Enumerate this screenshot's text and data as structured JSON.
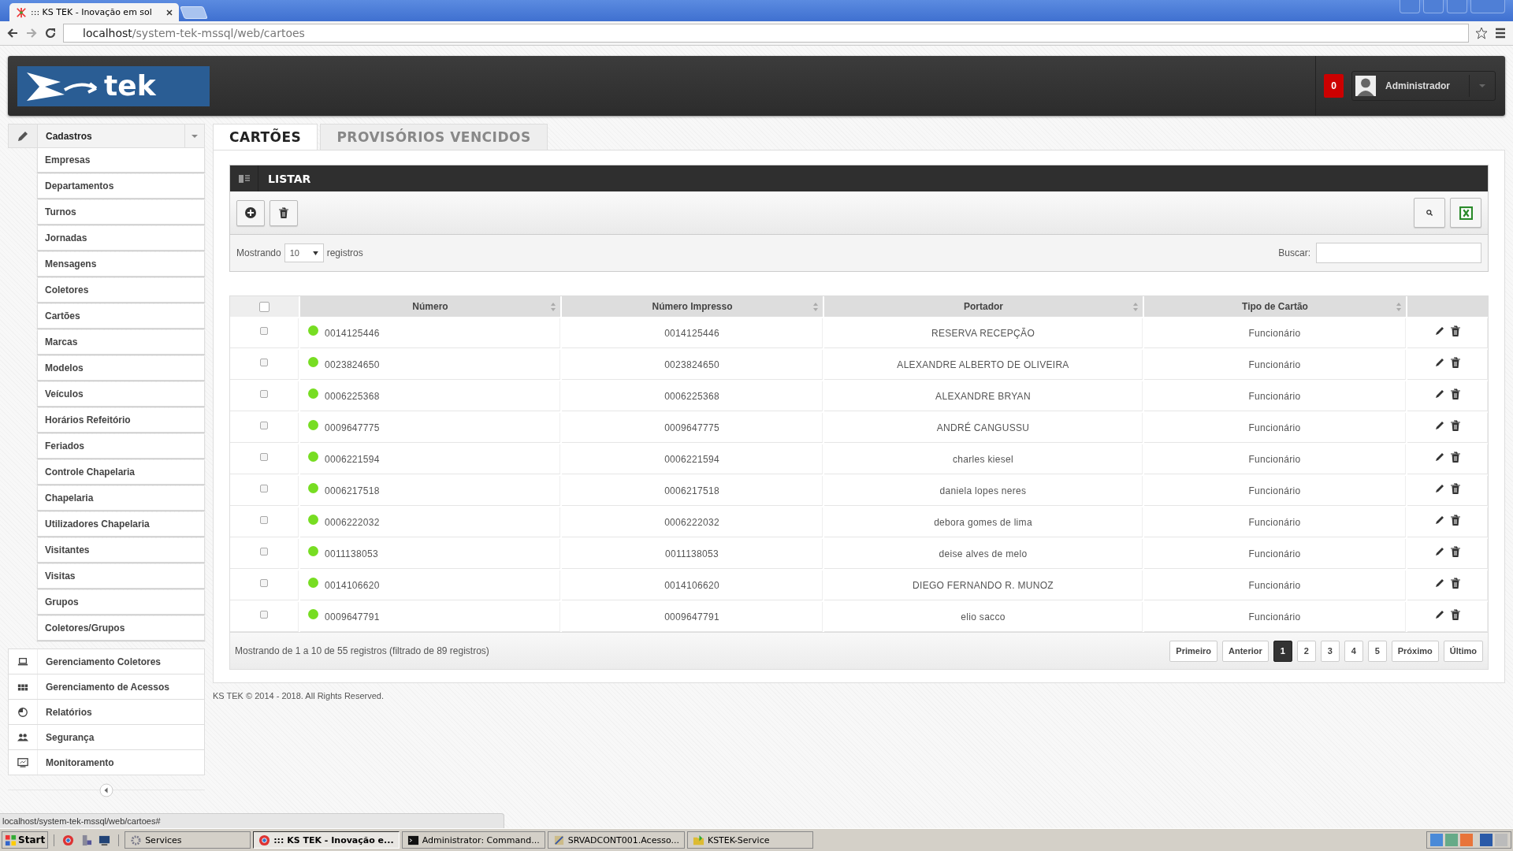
{
  "browser": {
    "tab_title": "::: KS TEK - Inovação em sol",
    "address_host": "localhost",
    "address_path": "/system-tek-mssql/web/cartoes"
  },
  "header": {
    "logo_text": "tek",
    "notification_count": "0",
    "user": "Administrador"
  },
  "sidebar": {
    "section": {
      "label": "Cadastros",
      "expanded": true,
      "children": [
        {
          "label": "Empresas"
        },
        {
          "label": "Departamentos"
        },
        {
          "label": "Turnos"
        },
        {
          "label": "Jornadas"
        },
        {
          "label": "Mensagens"
        },
        {
          "label": "Coletores"
        },
        {
          "label": "Cartões"
        },
        {
          "label": "Marcas"
        },
        {
          "label": "Modelos"
        },
        {
          "label": "Veículos"
        },
        {
          "label": "Horários Refeitório"
        },
        {
          "label": "Feriados"
        },
        {
          "label": "Controle Chapelaria"
        },
        {
          "label": "Chapelaria"
        },
        {
          "label": "Utilizadores Chapelaria"
        },
        {
          "label": "Visitantes"
        },
        {
          "label": "Visitas"
        },
        {
          "label": "Grupos"
        },
        {
          "label": "Coletores/Grupos"
        }
      ]
    },
    "modules": [
      {
        "label": "Gerenciamento Coletores",
        "kind": "laptop"
      },
      {
        "label": "Gerenciamento de Acessos",
        "kind": "grid"
      },
      {
        "label": "Relatórios",
        "kind": "pie"
      },
      {
        "label": "Segurança",
        "kind": "users"
      },
      {
        "label": "Monitoramento",
        "kind": "monitor"
      }
    ]
  },
  "tabs": [
    {
      "label": "CARTÕES",
      "selected": true
    },
    {
      "label": "PROVISÓRIOS VENCIDOS",
      "selected": false
    }
  ],
  "panel": {
    "title": "LISTAR",
    "length_label": "Mostrando",
    "length_value": "10",
    "length_suffix": "registros",
    "search_label": "Buscar:"
  },
  "table": {
    "select_all_checked": false,
    "columns": [
      {
        "label": "Número"
      },
      {
        "label": "Número Impresso"
      },
      {
        "label": "Portador"
      },
      {
        "label": "Tipo de Cartão"
      }
    ],
    "rows": [
      {
        "checked": false,
        "color": "#77dd22",
        "numero": "0014125446",
        "numero_impresso": "0014125446",
        "portador": "RESERVA RECEPÇÃO",
        "tipo": "Funcionário"
      },
      {
        "checked": false,
        "color": "#77dd22",
        "numero": "0023824650",
        "numero_impresso": "0023824650",
        "portador": "ALEXANDRE ALBERTO DE OLIVEIRA",
        "tipo": "Funcionário"
      },
      {
        "checked": false,
        "color": "#77dd22",
        "numero": "0006225368",
        "numero_impresso": "0006225368",
        "portador": "ALEXANDRE BRYAN",
        "tipo": "Funcionário"
      },
      {
        "checked": false,
        "color": "#77dd22",
        "numero": "0009647775",
        "numero_impresso": "0009647775",
        "portador": "ANDRÉ CANGUSSU",
        "tipo": "Funcionário"
      },
      {
        "checked": false,
        "color": "#77dd22",
        "numero": "0006221594",
        "numero_impresso": "0006221594",
        "portador": "charles kiesel",
        "tipo": "Funcionário"
      },
      {
        "checked": false,
        "color": "#77dd22",
        "numero": "0006217518",
        "numero_impresso": "0006217518",
        "portador": "daniela lopes neres",
        "tipo": "Funcionário"
      },
      {
        "checked": false,
        "color": "#77dd22",
        "numero": "0006222032",
        "numero_impresso": "0006222032",
        "portador": "debora gomes de lima",
        "tipo": "Funcionário"
      },
      {
        "checked": false,
        "color": "#77dd22",
        "numero": "0011138053",
        "numero_impresso": "0011138053",
        "portador": "deise alves de melo",
        "tipo": "Funcionário"
      },
      {
        "checked": false,
        "color": "#77dd22",
        "numero": "0014106620",
        "numero_impresso": "0014106620",
        "portador": "DIEGO FERNANDO R. MUNOZ",
        "tipo": "Funcionário"
      },
      {
        "checked": false,
        "color": "#77dd22",
        "numero": "0009647791",
        "numero_impresso": "0009647791",
        "portador": "elio sacco",
        "tipo": "Funcionário"
      }
    ]
  },
  "info": "Mostrando de 1 a 10 de 55 registros (filtrado de 89 registros)",
  "pagination": [
    {
      "label": "Primeiro",
      "selected": false
    },
    {
      "label": "Anterior",
      "selected": false
    },
    {
      "label": "1",
      "selected": true
    },
    {
      "label": "2",
      "selected": false
    },
    {
      "label": "3",
      "selected": false
    },
    {
      "label": "4",
      "selected": false
    },
    {
      "label": "5",
      "selected": false
    },
    {
      "label": "Próximo",
      "selected": false
    },
    {
      "label": "Último",
      "selected": false
    }
  ],
  "footer": "KS TEK © 2014 - 2018. All Rights Reserved.",
  "status_url": "localhost/system-tek-mssql/web/cartoes#",
  "taskbar": {
    "start": "Start",
    "tasks": [
      {
        "label": "Services",
        "selected": false,
        "kind": "gear"
      },
      {
        "label": "::: KS TEK - Inovação e...",
        "selected": true,
        "kind": "browser"
      },
      {
        "label": "Administrator: Command...",
        "selected": false,
        "kind": "console"
      },
      {
        "label": "SRVADCONT001.Acesso...",
        "selected": false,
        "kind": "tool"
      },
      {
        "label": "KSTEK-Service",
        "selected": false,
        "kind": "folder"
      }
    ]
  }
}
